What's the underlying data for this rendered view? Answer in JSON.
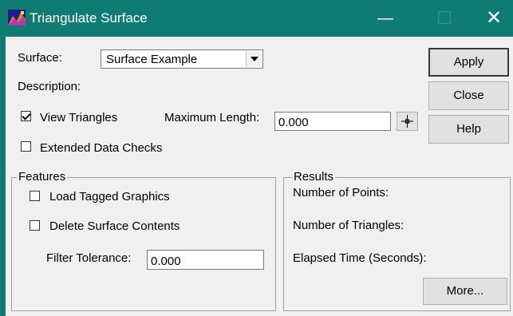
{
  "window": {
    "title": "Triangulate Surface",
    "title_bar_color": "#0f7b73",
    "minimize_glyph": "—",
    "maximize_glyph": "☐",
    "close_glyph": "✕"
  },
  "surface": {
    "label": "Surface:",
    "selected": "Surface Example"
  },
  "description": {
    "label": "Description:"
  },
  "view_triangles": {
    "label": "View Triangles",
    "checked": true
  },
  "max_length": {
    "label": "Maximum Length:",
    "value": "0.000",
    "pick_icon": "crosshair-icon"
  },
  "extended_checks": {
    "label": "Extended Data Checks",
    "checked": false
  },
  "buttons": {
    "apply": "Apply",
    "close": "Close",
    "help": "Help",
    "more": "More..."
  },
  "features": {
    "title": "Features",
    "load_tagged": {
      "label": "Load Tagged Graphics",
      "checked": false
    },
    "delete_contents": {
      "label": "Delete Surface Contents",
      "checked": false
    },
    "filter_tolerance": {
      "label": "Filter Tolerance:",
      "value": "0.000"
    }
  },
  "results": {
    "title": "Results",
    "points_label": "Number of Points:",
    "triangles_label": "Number of Triangles:",
    "elapsed_label": "Elapsed Time (Seconds):"
  }
}
